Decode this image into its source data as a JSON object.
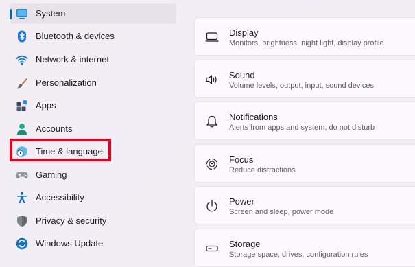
{
  "accent_color": "#0067c0",
  "highlight_color": "#e8001a",
  "sidebar": {
    "selected": "System",
    "highlighted": "Time & language",
    "items": [
      {
        "label": "System",
        "icon": "monitor-icon"
      },
      {
        "label": "Bluetooth & devices",
        "icon": "bluetooth-icon"
      },
      {
        "label": "Network & internet",
        "icon": "wifi-icon"
      },
      {
        "label": "Personalization",
        "icon": "brush-icon"
      },
      {
        "label": "Apps",
        "icon": "apps-icon"
      },
      {
        "label": "Accounts",
        "icon": "person-icon"
      },
      {
        "label": "Time & language",
        "icon": "globe-clock-icon"
      },
      {
        "label": "Gaming",
        "icon": "gamepad-icon"
      },
      {
        "label": "Accessibility",
        "icon": "accessibility-icon"
      },
      {
        "label": "Privacy & security",
        "icon": "shield-icon"
      },
      {
        "label": "Windows Update",
        "icon": "sync-icon"
      }
    ]
  },
  "settings": [
    {
      "title": "Display",
      "description": "Monitors, brightness, night light, display profile",
      "icon": "display-icon"
    },
    {
      "title": "Sound",
      "description": "Volume levels, output, input, sound devices",
      "icon": "speaker-icon"
    },
    {
      "title": "Notifications",
      "description": "Alerts from apps and system, do not disturb",
      "icon": "bell-icon"
    },
    {
      "title": "Focus",
      "description": "Reduce distractions",
      "icon": "focus-icon"
    },
    {
      "title": "Power",
      "description": "Screen and sleep, power mode",
      "icon": "power-icon"
    },
    {
      "title": "Storage",
      "description": "Storage space, drives, configuration rules",
      "icon": "storage-icon"
    }
  ]
}
